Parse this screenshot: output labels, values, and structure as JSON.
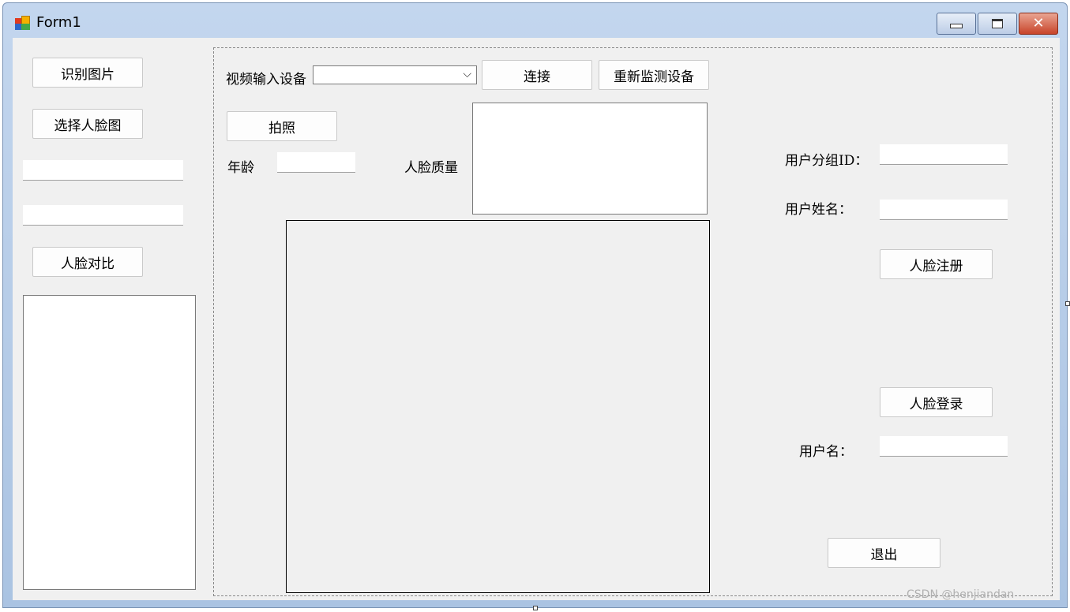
{
  "window": {
    "title": "Form1"
  },
  "titlebar_buttons": {
    "minimize_icon": "minimize-icon",
    "maximize_icon": "maximize-icon",
    "close_icon": "close-icon",
    "close_glyph": "✕"
  },
  "left_panel": {
    "recognize_image_button": "识别图片",
    "select_face_button": "选择人脸图",
    "face_compare_button": "人脸对比"
  },
  "camera_panel": {
    "video_device_label": "视频输入设备",
    "combo_arrow": "⌵",
    "connect_button": "连接",
    "redetect_button": "重新监测设备",
    "photo_button": "拍照",
    "age_label": "年龄",
    "face_quality_label": "人脸质量"
  },
  "user_panel": {
    "group_id_label": "用户分组ID：",
    "username_label": "用户姓名：",
    "register_button": "人脸注册",
    "login_button": "人脸登录",
    "login_username_label": "用户名：",
    "exit_button": "退出"
  },
  "watermark": "CSDN @henjiandan",
  "colors": {
    "client_bg": "#f0f0f0",
    "title_gradient_top": "#c3d6ee",
    "close_button": "#c8442a"
  }
}
